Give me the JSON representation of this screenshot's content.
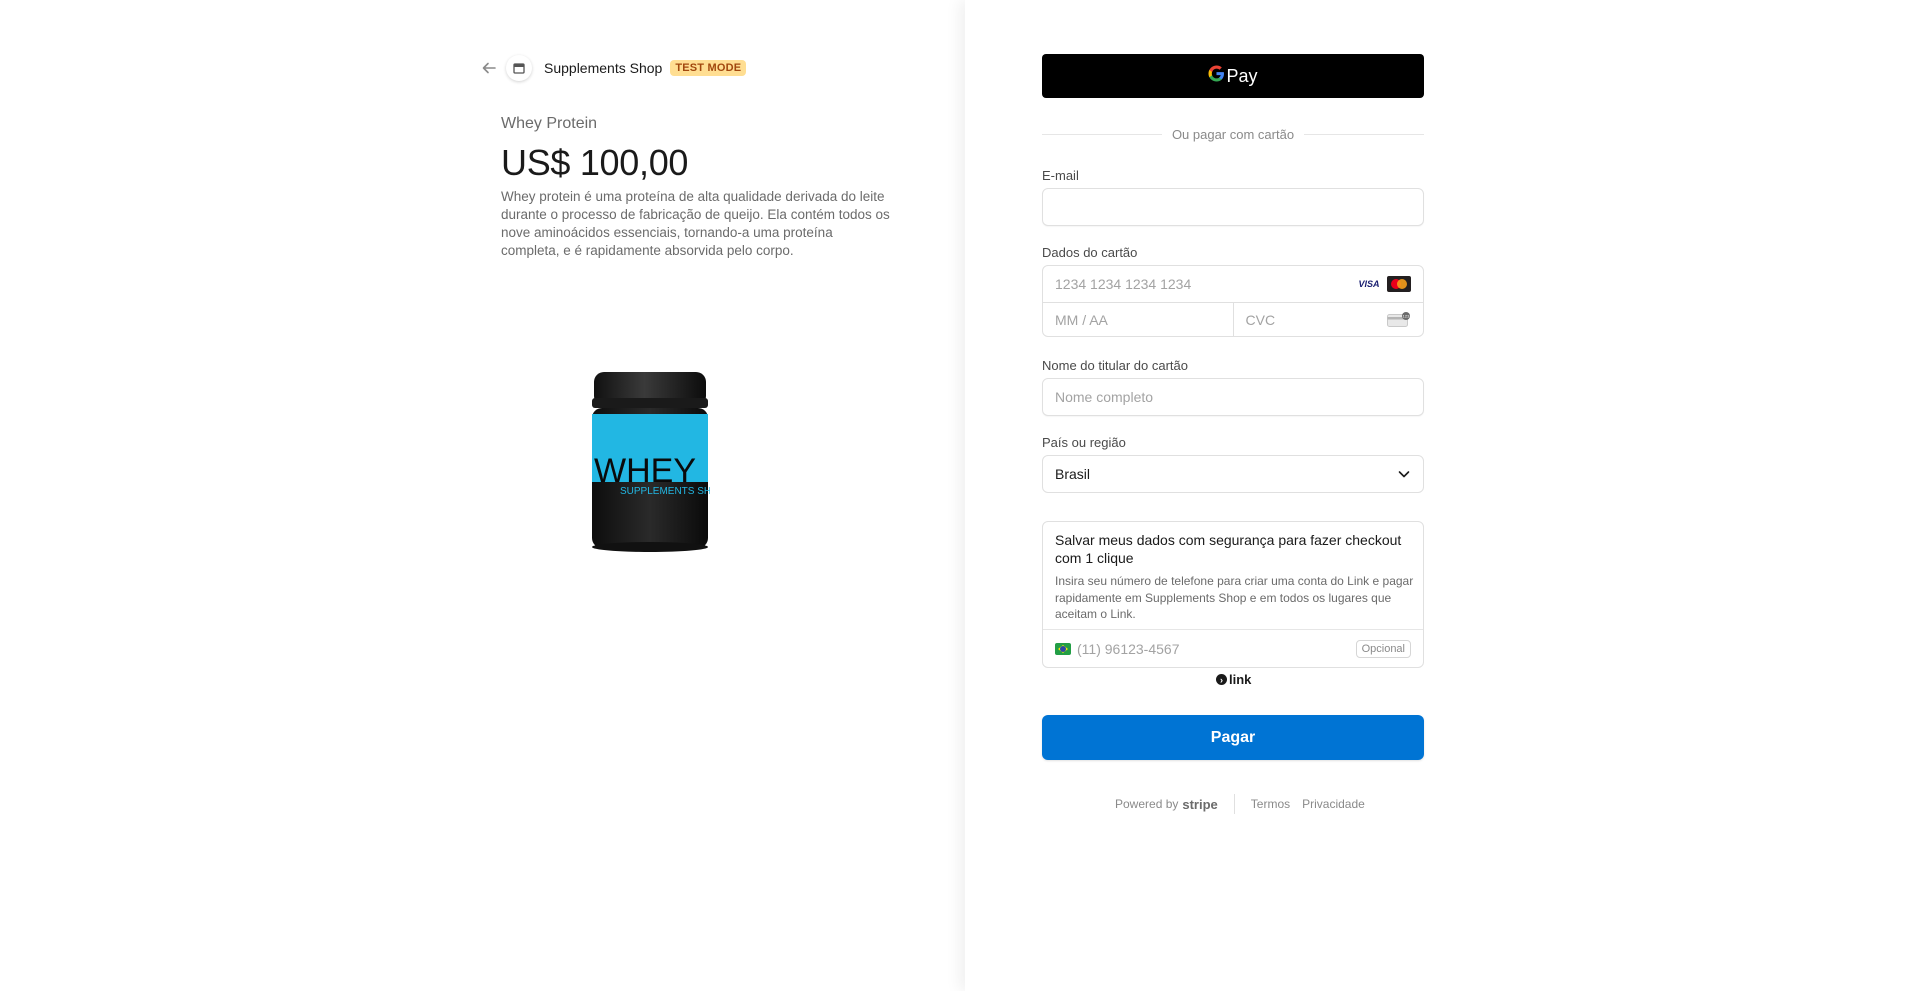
{
  "header": {
    "shop_name": "Supplements Shop",
    "test_badge": "TEST MODE"
  },
  "product": {
    "name": "Whey Protein",
    "price": "US$ 100,00",
    "description": "Whey protein é uma proteína de alta qualidade derivada do leite durante o processo de fabricação de queijo. Ela contém todos os nove aminoácidos essenciais, tornando-a uma proteína completa, e é rapidamente absorvida pelo corpo.",
    "image_label": "WHEY",
    "image_sublabel": "SUPPLEMENTS SHOP"
  },
  "payment": {
    "gpay_label": "Pay",
    "divider_text": "Ou pagar com cartão",
    "email_label": "E-mail",
    "card_label": "Dados do cartão",
    "card_number_placeholder": "1234 1234 1234 1234",
    "expiry_placeholder": "MM / AA",
    "cvc_placeholder": "CVC",
    "visa_text": "VISA",
    "holder_label": "Nome do titular do cartão",
    "holder_placeholder": "Nome completo",
    "country_label": "País ou região",
    "country_value": "Brasil",
    "link_title": "Salvar meus dados com segurança para fazer checkout com 1 clique",
    "link_desc": "Insira seu número de telefone para criar uma conta do Link e pagar rapidamente em Supplements Shop e em todos os lugares que aceitam o Link.",
    "phone_placeholder": "(11) 96123-4567",
    "optional_label": "Opcional",
    "link_logo_text": "link",
    "pay_button": "Pagar"
  },
  "footer": {
    "powered_by": "Powered by",
    "stripe": "stripe",
    "terms": "Termos",
    "privacy": "Privacidade"
  },
  "colors": {
    "pay_button": "#0074d4",
    "test_badge_bg": "#ffde92",
    "product_blue": "#22b7e3"
  }
}
